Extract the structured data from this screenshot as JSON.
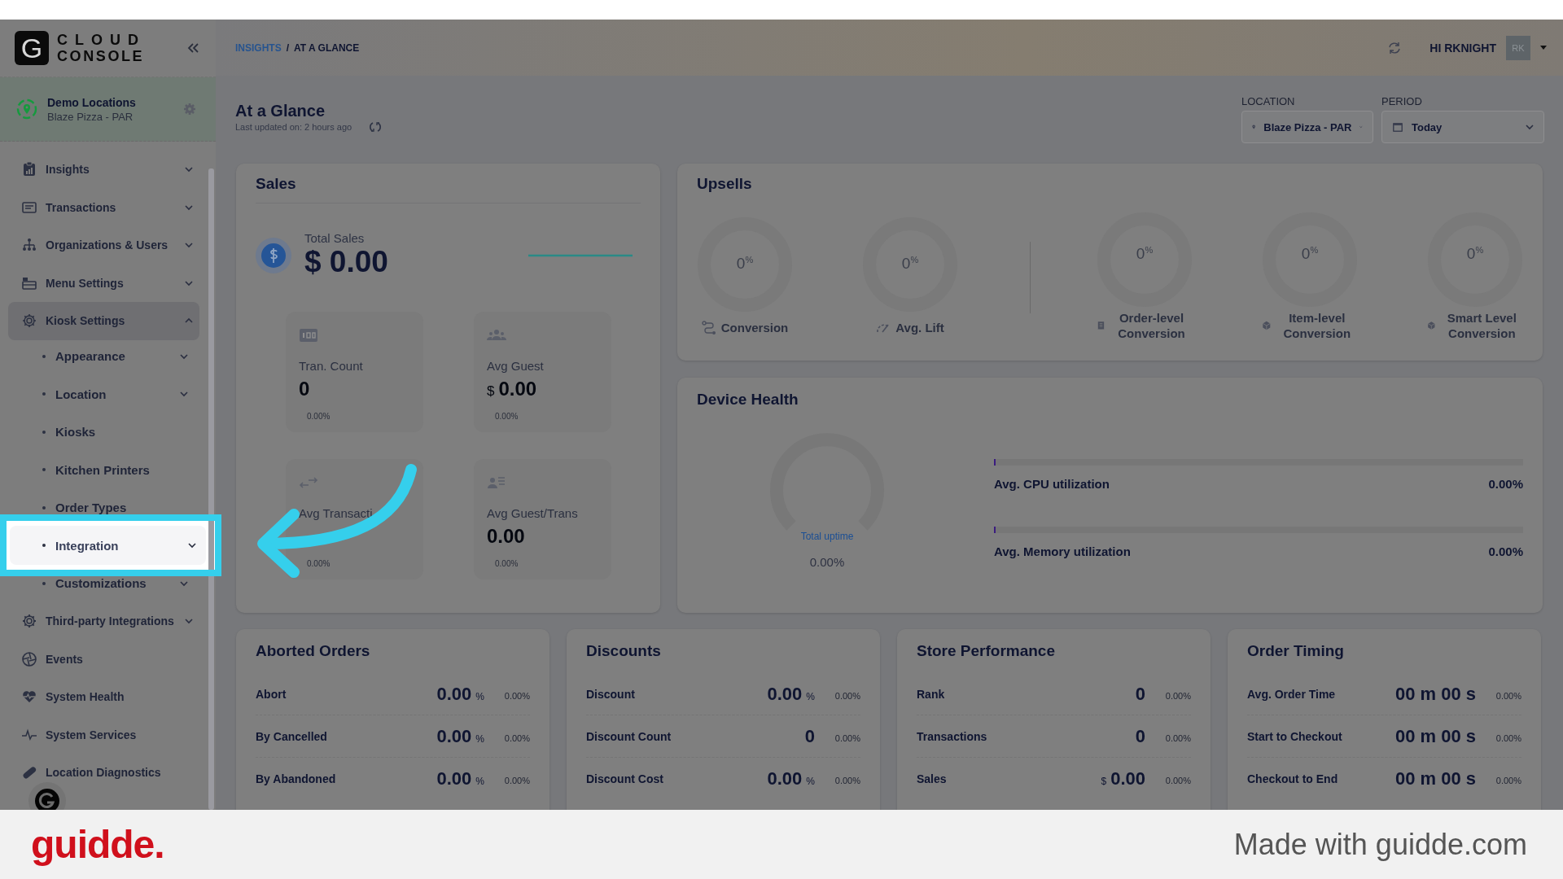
{
  "brand": {
    "logo_letter": "G",
    "line1": "CLOUD",
    "line2": "CONSOLE"
  },
  "location_switcher": {
    "title": "Demo Locations",
    "subtitle": "Blaze Pizza - PAR"
  },
  "sidebar": {
    "items": [
      {
        "label": "Insights",
        "kind": "group",
        "expanded": false,
        "selected": false
      },
      {
        "label": "Transactions",
        "kind": "group",
        "expanded": false,
        "selected": false
      },
      {
        "label": "Organizations & Users",
        "kind": "group",
        "expanded": false,
        "selected": false
      },
      {
        "label": "Menu Settings",
        "kind": "group",
        "expanded": false,
        "selected": false
      },
      {
        "label": "Kiosk Settings",
        "kind": "group",
        "expanded": true,
        "selected": true,
        "children": [
          {
            "label": "Appearance",
            "kind": "group",
            "expanded": false,
            "selected": false
          },
          {
            "label": "Location",
            "kind": "group",
            "expanded": false,
            "selected": false
          },
          {
            "label": "Kiosks",
            "kind": "link",
            "selected": false
          },
          {
            "label": "Kitchen Printers",
            "kind": "link",
            "selected": false
          },
          {
            "label": "Order Types",
            "kind": "link",
            "selected": false
          },
          {
            "label": "Integration",
            "kind": "group",
            "expanded": false,
            "selected": true
          },
          {
            "label": "Customizations",
            "kind": "group",
            "expanded": false,
            "selected": false
          }
        ]
      },
      {
        "label": "Third-party Integrations",
        "kind": "group",
        "expanded": false,
        "selected": false
      },
      {
        "label": "Events",
        "kind": "link",
        "selected": false
      },
      {
        "label": "System Health",
        "kind": "link",
        "selected": false
      },
      {
        "label": "System Services",
        "kind": "link",
        "selected": false
      },
      {
        "label": "Location Diagnostics",
        "kind": "link",
        "selected": false
      }
    ]
  },
  "breadcrumb": [
    {
      "label": "INSIGHTS",
      "kind": "link"
    },
    {
      "label": "/",
      "kind": "separator"
    },
    {
      "label": "AT A GLANCE",
      "kind": "current"
    }
  ],
  "user": {
    "greeting": "HI RKNIGHT",
    "initials": "RK"
  },
  "page": {
    "title": "At a Glance",
    "updated": "Last updated on: 2 hours ago"
  },
  "filters": [
    {
      "label": "LOCATION",
      "value": "Blaze Pizza - PAR",
      "kind": "location"
    },
    {
      "label": "PERIOD",
      "value": "Today",
      "kind": "period"
    }
  ],
  "sales": {
    "title": "Sales",
    "total_label": "Total Sales",
    "total_value": "$ 0.00",
    "metrics": [
      {
        "label": "Tran. Count",
        "value": "0",
        "change": "0.00%"
      },
      {
        "label": "Avg Guest",
        "prefix": "$",
        "value": "0.00",
        "change": "0.00%"
      },
      {
        "label": "Avg Transacti",
        "change": "0.00%"
      },
      {
        "label": "Avg Guest/Trans",
        "value": "0.00",
        "change": "0.00%"
      }
    ]
  },
  "upsells": {
    "title": "Upsells",
    "primary": [
      {
        "value": "0",
        "unit": "%",
        "label": "Conversion"
      },
      {
        "value": "0",
        "unit": "%",
        "label": "Avg. Lift"
      }
    ],
    "breakdown": [
      {
        "value": "0",
        "unit": "%",
        "label": "Order-level Conversion"
      },
      {
        "value": "0",
        "unit": "%",
        "label": "Item-level Conversion"
      },
      {
        "value": "0",
        "unit": "%",
        "label": "Smart Level Conversion"
      }
    ]
  },
  "device_health": {
    "title": "Device Health",
    "uptime": {
      "label": "Total uptime",
      "value": "0.00%"
    },
    "meters": [
      {
        "label": "Avg. CPU utilization",
        "value": "0.00%",
        "level": 0
      },
      {
        "label": "Avg. Memory utilization",
        "value": "0.00%",
        "level": 0
      }
    ]
  },
  "summary_cards": [
    {
      "title": "Aborted Orders",
      "rows": [
        {
          "label": "Abort",
          "value": "0.00",
          "unit": "%",
          "change": "0.00%"
        },
        {
          "label": "By Cancelled",
          "value": "0.00",
          "unit": "%",
          "change": "0.00%"
        },
        {
          "label": "By Abandoned",
          "value": "0.00",
          "unit": "%",
          "change": "0.00%"
        }
      ]
    },
    {
      "title": "Discounts",
      "rows": [
        {
          "label": "Discount",
          "value": "0.00",
          "unit": "%",
          "change": "0.00%"
        },
        {
          "label": "Discount Count",
          "value": "0",
          "change": "0.00%"
        },
        {
          "label": "Discount Cost",
          "value": "0.00",
          "unit": "%",
          "change": "0.00%"
        }
      ]
    },
    {
      "title": "Store Performance",
      "rows": [
        {
          "label": "Rank",
          "value": "0",
          "change": "0.00%"
        },
        {
          "label": "Transactions",
          "value": "0",
          "change": "0.00%"
        },
        {
          "label": "Sales",
          "prefix": "$",
          "value": "0.00",
          "change": "0.00%"
        }
      ]
    },
    {
      "title": "Order Timing",
      "rows": [
        {
          "label": "Avg. Order Time",
          "value": "00 m 00 s",
          "change": "0.00%"
        },
        {
          "label": "Start to Checkout",
          "value": "00 m 00 s",
          "change": "0.00%"
        },
        {
          "label": "Checkout to End",
          "value": "00 m 00 s",
          "change": "0.00%"
        }
      ]
    }
  ],
  "footer": {
    "logo": "guidde.",
    "credit": "Made with guidde.com"
  }
}
